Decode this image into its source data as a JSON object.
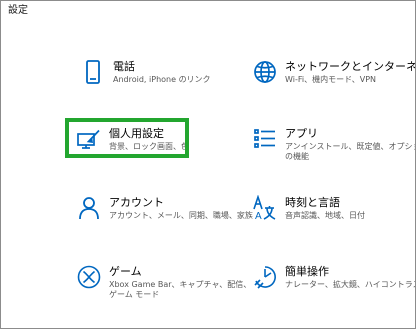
{
  "window": {
    "title": "設定"
  },
  "tiles": {
    "phone": {
      "title": "電話",
      "description": "Android, iPhone のリンク",
      "icon": "phone-icon"
    },
    "network": {
      "title": "ネットワークとインターネット",
      "description": "Wi-Fi、機内モード、VPN",
      "icon": "globe-icon"
    },
    "personalization": {
      "title": "個人用設定",
      "description": "背景、ロック画面、色",
      "icon": "paint-brush-monitor-icon"
    },
    "apps": {
      "title": "アプリ",
      "description": "アンインストール、既定値、オプションの機能",
      "icon": "apps-list-icon"
    },
    "accounts": {
      "title": "アカウント",
      "description": "アカウント、メール、同期、職場、家族",
      "icon": "person-icon"
    },
    "time_language": {
      "title": "時刻と言語",
      "description": "音声認識、地域、日付",
      "icon": "language-time-icon"
    },
    "gaming": {
      "title": "ゲーム",
      "description": "Xbox Game Bar、キャプチャ、配信、ゲーム モード",
      "icon": "xbox-icon"
    },
    "accessibility": {
      "title": "簡単操作",
      "description": "ナレーター、拡大鏡、ハイコントラスト",
      "icon": "accessibility-timer-icon"
    }
  },
  "colors": {
    "accent": "#0067c0",
    "highlight": "#23a62f"
  }
}
